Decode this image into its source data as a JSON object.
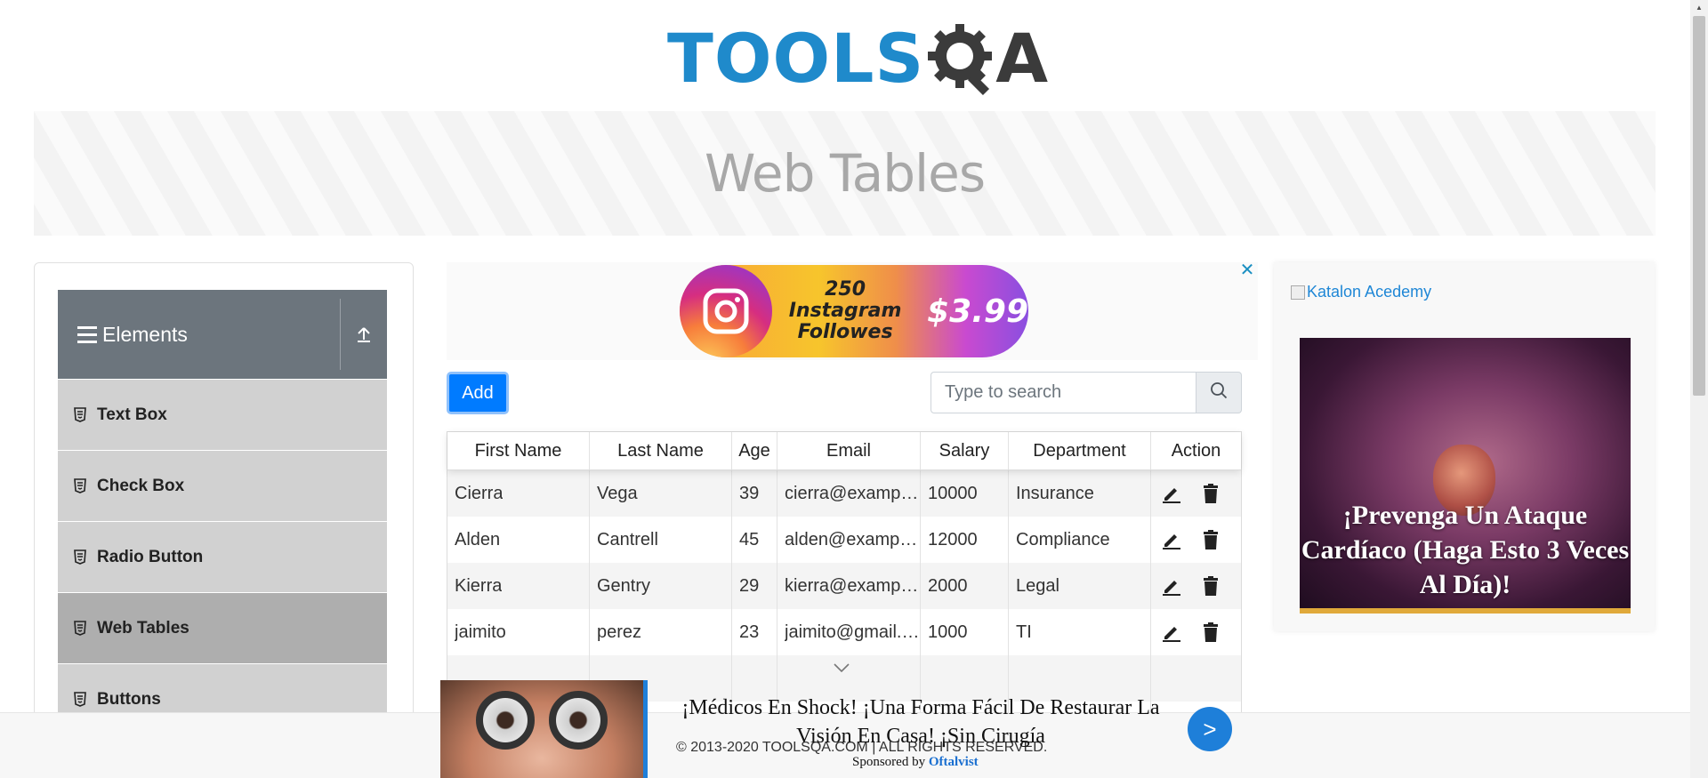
{
  "header": {
    "logo_main": "TOOLS",
    "logo_end": "A"
  },
  "banner": {
    "title": "Web Tables"
  },
  "sidebar": {
    "group_title": "Elements",
    "items": [
      {
        "label": "Text Box"
      },
      {
        "label": "Check Box"
      },
      {
        "label": "Radio Button"
      },
      {
        "label": "Web Tables"
      },
      {
        "label": "Buttons"
      }
    ]
  },
  "ad_top": {
    "text": "250 Instagram Followes",
    "price": "$3.99",
    "close": "✕"
  },
  "controls": {
    "add_label": "Add",
    "search_placeholder": "Type to search"
  },
  "table": {
    "columns": [
      "First Name",
      "Last Name",
      "Age",
      "Email",
      "Salary",
      "Department",
      "Action"
    ],
    "rows": [
      [
        "Cierra",
        "Vega",
        "39",
        "cierra@example.com",
        "10000",
        "Insurance"
      ],
      [
        "Alden",
        "Cantrell",
        "45",
        "alden@example.com",
        "12000",
        "Compliance"
      ],
      [
        "Kierra",
        "Gentry",
        "29",
        "kierra@example.com",
        "2000",
        "Legal"
      ],
      [
        "jaimito",
        "perez",
        "23",
        "jaimito@gmail.com",
        "1000",
        "TI"
      ]
    ]
  },
  "ad_right": {
    "alt_text": "Katalon Acedemy",
    "headline": "¡Prevenga Un Ataque Cardíaco (Haga Esto 3 Veces Al Día)!"
  },
  "footer": {
    "copyright": "© 2013-2020 TOOLSQA.COM | ALL RIGHTS RESERVED."
  },
  "ad_bottom": {
    "headline": "¡Médicos En Shock! ¡Una Forma Fácil De Restaurar La Visión En Casa! ¡Sin Cirugía",
    "sponsor_prefix": "Sponsored by",
    "sponsor_name": "Oftalvist",
    "go": ">"
  },
  "colors": {
    "brand_blue": "#1f8acb",
    "primary": "#007bff",
    "sidebar_header": "#6c757d"
  }
}
